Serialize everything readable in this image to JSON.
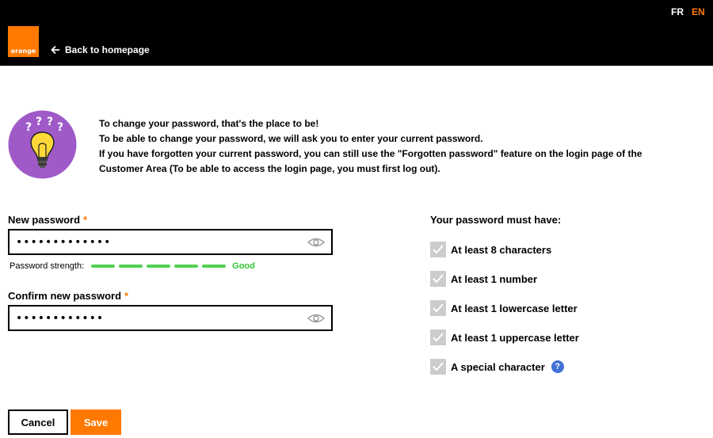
{
  "header": {
    "logo_text": "orange",
    "back_label": "Back to homepage",
    "lang_fr": "FR",
    "lang_en": "EN"
  },
  "intro": {
    "line1": "To change your password, that's the place to be!",
    "line2": "To be able to change your password, we will ask you to enter your current password.",
    "line3": "If you have forgotten your current password, you can still use the \"Forgotten password\" feature on the login page of the Customer Area (To be able to access the login page, you must first log out)."
  },
  "form": {
    "new_password_label": "New password",
    "new_password_value": "•••••••••••••",
    "required_mark": "*",
    "strength_label": "Password strength:",
    "strength_value": "Good",
    "confirm_label": "Confirm new password",
    "confirm_value": "••••••••••••"
  },
  "rules": {
    "title": "Your password must have:",
    "items": [
      "At least 8 characters",
      "At least 1 number",
      "At least 1 lowercase letter",
      "At least 1 uppercase letter",
      "A special character"
    ],
    "help_glyph": "?"
  },
  "buttons": {
    "cancel": "Cancel",
    "save": "Save"
  },
  "colors": {
    "brand": "#ff7900",
    "strength_good": "#32c832",
    "help": "#4170d8"
  }
}
